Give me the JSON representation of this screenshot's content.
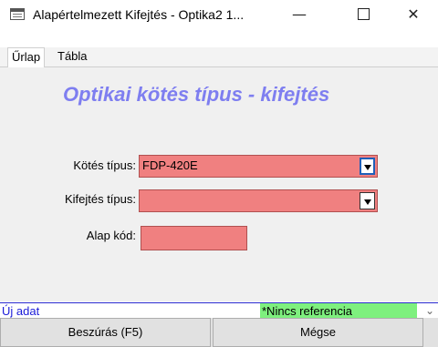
{
  "window": {
    "title": "Alapértelmezett Kifejtés - Optika2 1...",
    "minimize": "—",
    "close": "✕"
  },
  "tabs": [
    {
      "label": "Űrlap"
    },
    {
      "label": "Tábla"
    }
  ],
  "form": {
    "heading": "Optikai kötés típus - kifejtés",
    "fields": {
      "kotes_tipus": {
        "label": "Kötés típus:",
        "value": "FDP-420E"
      },
      "kifejtes_tipus": {
        "label": "Kifejtés típus:",
        "value": ""
      },
      "alap_kod": {
        "label": "Alap kód:",
        "value": ""
      }
    },
    "field_color": "#f08080"
  },
  "status": {
    "new_record": "Új adat",
    "reference": "*Nincs referencia",
    "reference_color": "#7ef07e"
  },
  "buttons": {
    "insert": "Beszúrás (F5)",
    "cancel": "Mégse"
  },
  "icons": {
    "app": "form-window-icon",
    "dropdown": "dropdown-arrow-icon",
    "scroll": "chevron-down-icon"
  }
}
